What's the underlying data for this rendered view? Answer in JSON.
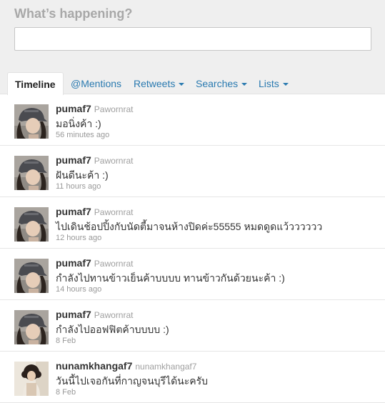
{
  "compose": {
    "prompt": "What’s happening?",
    "value": ""
  },
  "tabs": [
    {
      "label": "Timeline",
      "dropdown": false
    },
    {
      "label": "@Mentions",
      "dropdown": false
    },
    {
      "label": "Retweets",
      "dropdown": true
    },
    {
      "label": "Searches",
      "dropdown": true
    },
    {
      "label": "Lists",
      "dropdown": true
    }
  ],
  "tweets": [
    {
      "screen_name": "pumaf7",
      "full_name": "Pawornrat",
      "text": "มอนิ่งค้า :)",
      "time": "56 minutes ago",
      "avatar": "girl-cap-photo"
    },
    {
      "screen_name": "pumaf7",
      "full_name": "Pawornrat",
      "text": "ฝันดีนะค้า :)",
      "time": "11 hours ago",
      "avatar": "girl-cap-photo"
    },
    {
      "screen_name": "pumaf7",
      "full_name": "Pawornrat",
      "text": "ไปเดินช้อปปิ้งกับนัดตี้มาจนห้างปิดค่ะ55555 หมดดูดแว้วววววว",
      "time": "12 hours ago",
      "avatar": "girl-cap-photo"
    },
    {
      "screen_name": "pumaf7",
      "full_name": "Pawornrat",
      "text": "กำลังไปทานข้าวเย็นค้าบบบบ ทานข้าวกันด้วยนะค้า :)",
      "time": "14 hours ago",
      "avatar": "girl-cap-photo"
    },
    {
      "screen_name": "pumaf7",
      "full_name": "Pawornrat",
      "text": "กำลังไปออฟฟิตค้าบบบบ :)",
      "time": "8 Feb",
      "avatar": "girl-cap-photo"
    },
    {
      "screen_name": "nunamkhangaf7",
      "full_name": "nunamkhangaf7",
      "text": "วันนี้ไปเจอกันที่กาญจนบุรีได้นะครับ",
      "time": "8 Feb",
      "avatar": "girl-curly-photo"
    }
  ],
  "colors": {
    "link": "#2a7ab0",
    "header_bg": "#efefef"
  }
}
